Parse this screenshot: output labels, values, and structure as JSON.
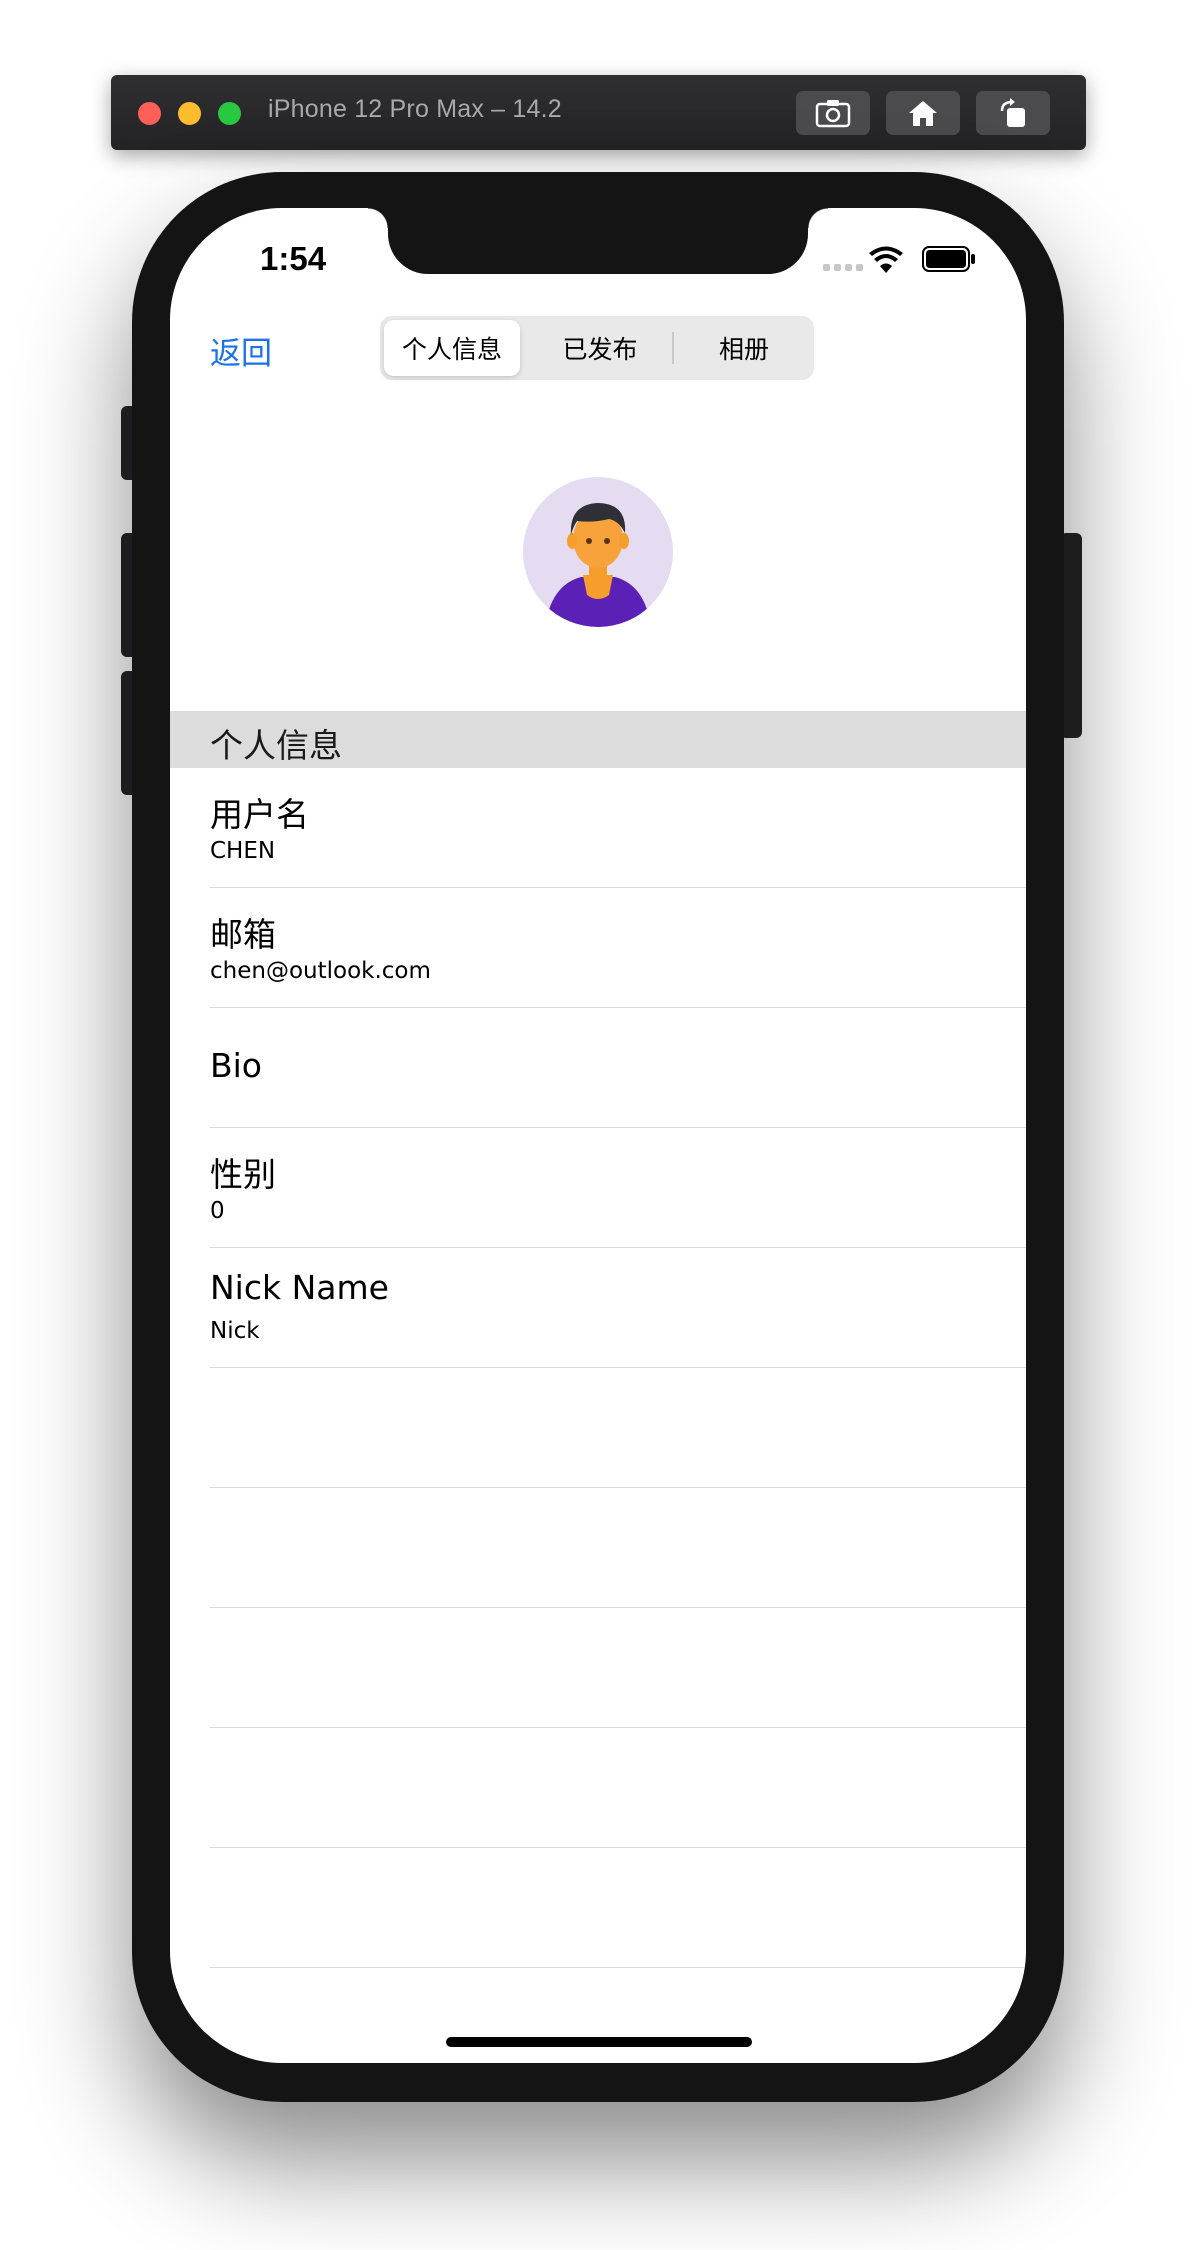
{
  "simulator": {
    "title": "iPhone 12 Pro Max – 14.2",
    "buttons": [
      "screenshot-icon",
      "home-icon",
      "rotate-icon"
    ]
  },
  "status_bar": {
    "time": "1:54"
  },
  "nav": {
    "back_label": "返回",
    "segments": [
      "个人信息",
      "已发布",
      "相册"
    ],
    "selected_segment": "个人信息"
  },
  "profile": {
    "avatar_icon": "person-avatar-icon",
    "section_title": "个人信息",
    "fields": [
      {
        "label": "用户名",
        "value": "CHEN"
      },
      {
        "label": "邮箱",
        "value": "chen@outlook.com"
      },
      {
        "label": "Bio",
        "value": ""
      },
      {
        "label": "性别",
        "value": "0"
      },
      {
        "label": "Nick Name",
        "value": "Nick"
      }
    ]
  },
  "colors": {
    "accent": "#1a73e8",
    "section_bg": "#dcdcdc",
    "avatar_bg": "#e5dcf2",
    "avatar_shirt": "#5b21b6",
    "avatar_skin": "#f7a23b"
  }
}
